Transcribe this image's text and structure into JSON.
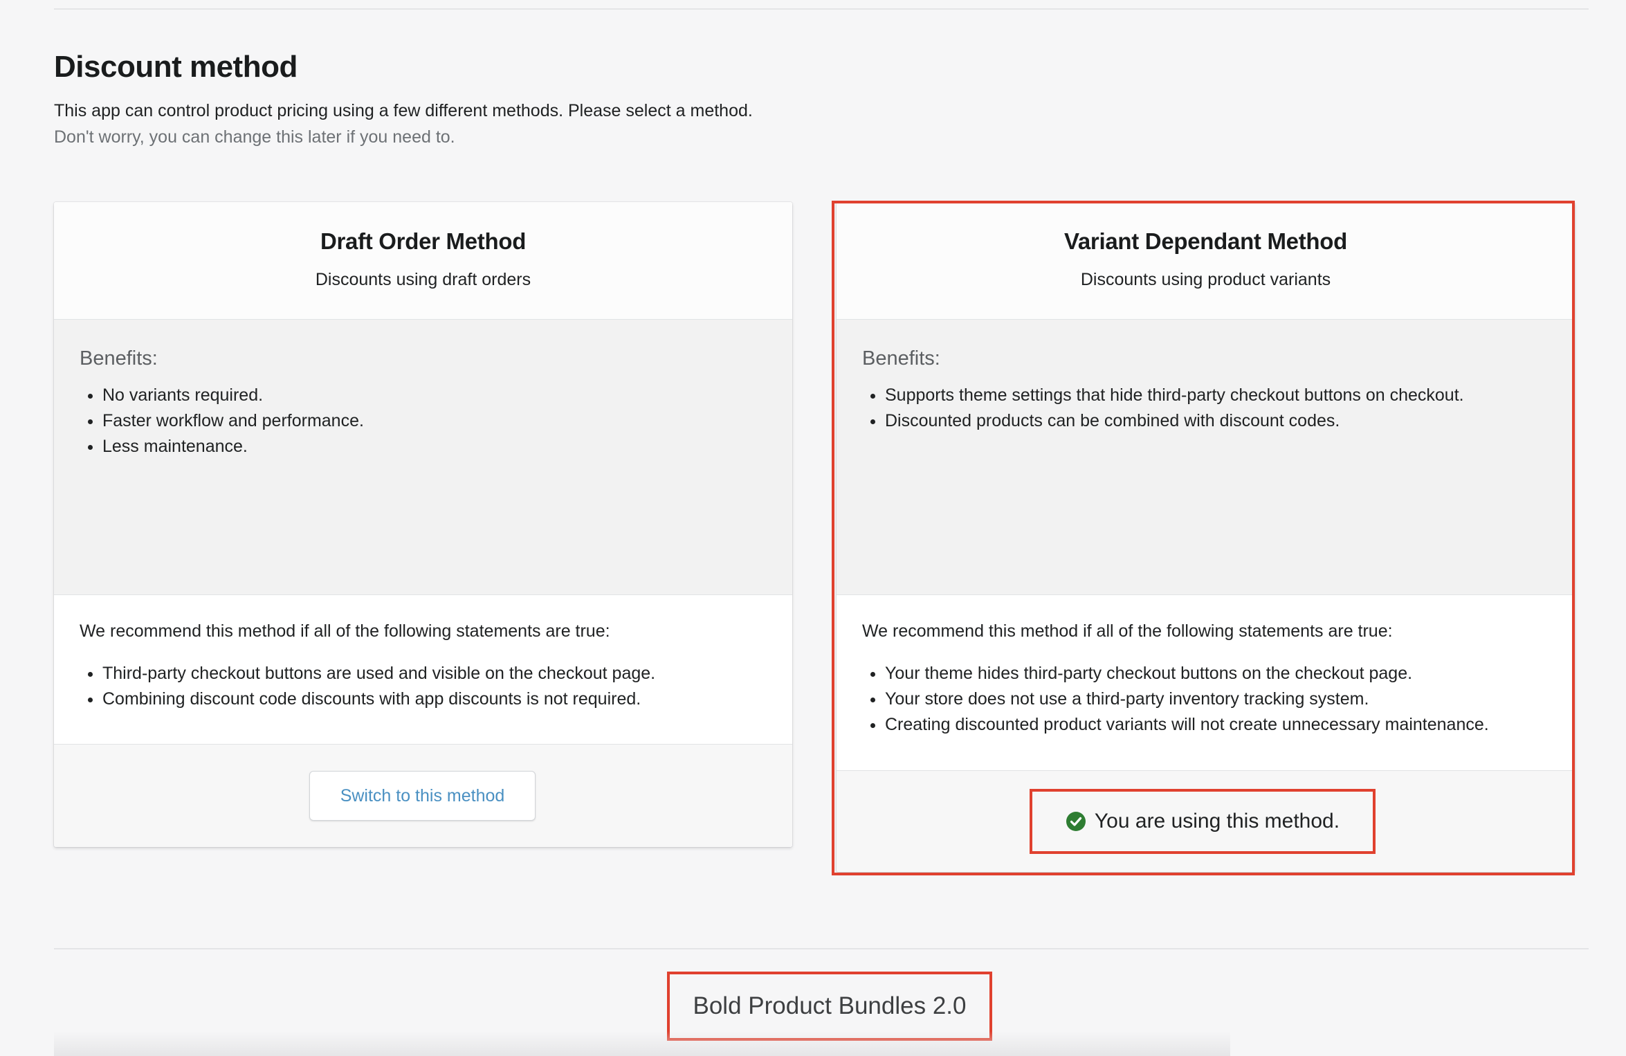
{
  "section": {
    "title": "Discount method",
    "description": "This app can control product pricing using a few different methods. Please select a method.",
    "note": "Don't worry, you can change this later if you need to."
  },
  "cards": [
    {
      "title": "Draft Order Method",
      "subtitle": "Discounts using draft orders",
      "benefits_title": "Benefits:",
      "benefits": [
        "No variants required.",
        "Faster workflow and performance.",
        "Less maintenance."
      ],
      "recommend_title": "We recommend this method if all of the following statements are true:",
      "recommend": [
        "Third-party checkout buttons are used and visible on the checkout page.",
        "Combining discount code discounts with app discounts is not required."
      ],
      "action_label": "Switch to this method"
    },
    {
      "title": "Variant Dependant Method",
      "subtitle": "Discounts using product variants",
      "benefits_title": "Benefits:",
      "benefits": [
        "Supports theme settings that hide third-party checkout buttons on checkout.",
        "Discounted products can be combined with discount codes."
      ],
      "recommend_title": "We recommend this method if all of the following statements are true:",
      "recommend": [
        "Your theme hides third-party checkout buttons on the checkout page.",
        "Your store does not use a third-party inventory tracking system.",
        "Creating discounted product variants will not create unnecessary maintenance."
      ],
      "status_label": "You are using this method.",
      "status_icon": "check-circle-icon"
    }
  ],
  "footer": {
    "app_name": "Bold Product Bundles 2.0"
  },
  "colors": {
    "highlight": "#e0412f",
    "link": "#4a90c2",
    "success": "#2e7d32"
  }
}
